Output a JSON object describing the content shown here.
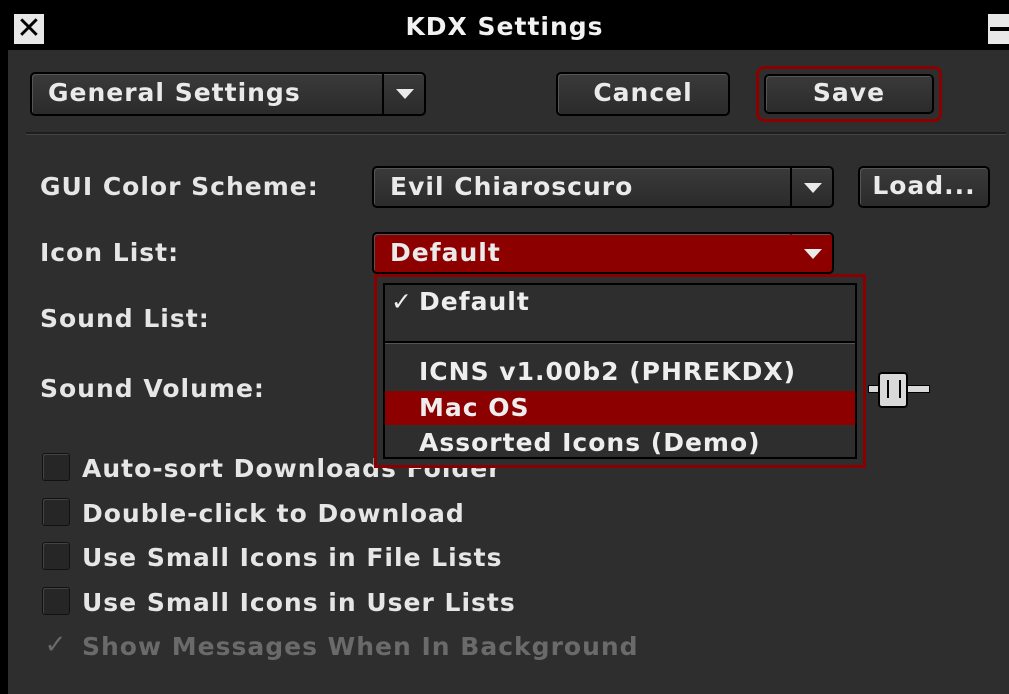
{
  "window": {
    "title": "KDX Settings"
  },
  "toolbar": {
    "section_select": "General Settings",
    "cancel_label": "Cancel",
    "save_label": "Save"
  },
  "settings": {
    "color_scheme_label": "GUI Color Scheme:",
    "color_scheme_value": "Evil Chiaroscuro",
    "load_label": "Load...",
    "icon_list_label": "Icon List:",
    "icon_list_value": "Default",
    "sound_list_label": "Sound List:",
    "sound_volume_label": "Sound Volume:"
  },
  "icon_menu": {
    "items": [
      {
        "label": "Default",
        "checked": true
      },
      {
        "label": "ICNS v1.00b2 (PHREKDX)"
      },
      {
        "label": "Mac OS",
        "highlighted": true
      },
      {
        "label": "Assorted Icons (Demo)"
      }
    ],
    "check_mark": "✓"
  },
  "options": [
    {
      "label": "Auto-sort Downloads Folder",
      "checked": false
    },
    {
      "label": "Double-click to Download",
      "checked": false
    },
    {
      "label": "Use Small Icons in File Lists",
      "checked": false
    },
    {
      "label": "Use Small Icons in User Lists",
      "checked": false
    },
    {
      "label": "Show Messages When In Background",
      "checked": true,
      "disabled": true
    }
  ],
  "theme": {
    "accent": "#8c0000",
    "panel": "#2e2e2e",
    "text": "#e6e6e6"
  }
}
